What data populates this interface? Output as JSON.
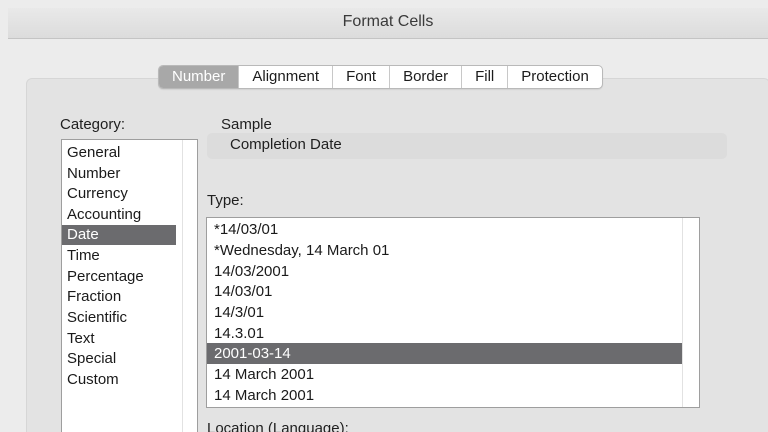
{
  "window": {
    "title": "Format Cells"
  },
  "tabs": [
    {
      "label": "Number",
      "selected": true
    },
    {
      "label": "Alignment",
      "selected": false
    },
    {
      "label": "Font",
      "selected": false
    },
    {
      "label": "Border",
      "selected": false
    },
    {
      "label": "Fill",
      "selected": false
    },
    {
      "label": "Protection",
      "selected": false
    }
  ],
  "category": {
    "label": "Category:",
    "items": [
      "General",
      "Number",
      "Currency",
      "Accounting",
      "Date",
      "Time",
      "Percentage",
      "Fraction",
      "Scientific",
      "Text",
      "Special",
      "Custom"
    ],
    "selected": "Date"
  },
  "sample": {
    "label": "Sample",
    "value": "Completion Date"
  },
  "type": {
    "label": "Type:",
    "items": [
      "*14/03/01",
      "*Wednesday, 14 March 01",
      "14/03/2001",
      "14/03/01",
      "14/3/01",
      "14.3.01",
      "2001-03-14",
      "14 March 2001",
      "14 March 2001"
    ],
    "selected": "2001-03-14"
  },
  "location": {
    "label": "Location (Language):"
  },
  "colors": {
    "selection": "#6b6b6e",
    "tab_selected": "#a8a8a8"
  }
}
